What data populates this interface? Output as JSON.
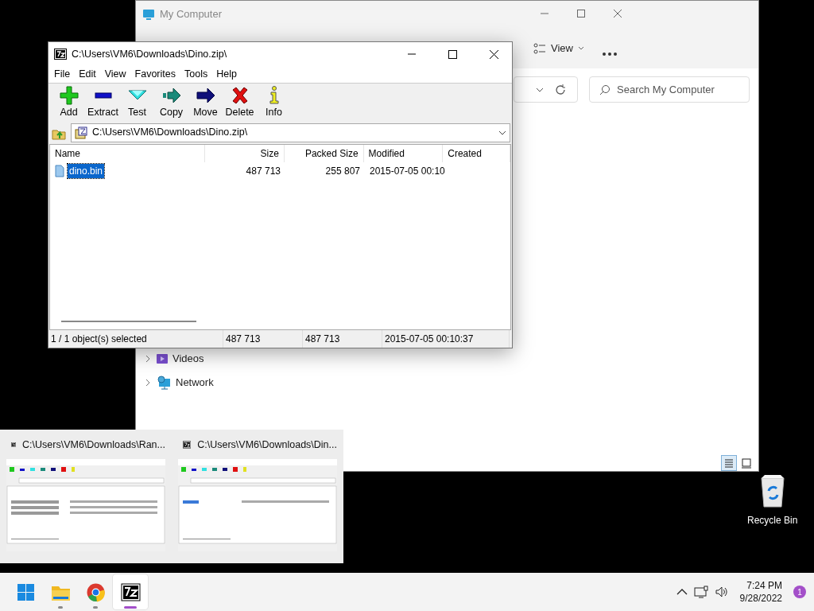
{
  "explorer_window": {
    "title": "My Computer",
    "view_button": "View",
    "search": {
      "placeholder": "Search My Computer"
    },
    "nav_items": [
      {
        "kind": "videos",
        "label": "Videos"
      },
      {
        "kind": "network",
        "label": "Network"
      }
    ],
    "view_toggles": [
      {
        "kind": "details",
        "selected": true
      },
      {
        "kind": "tiles",
        "selected": false
      }
    ]
  },
  "archive_window": {
    "title": "C:\\Users\\VM6\\Downloads\\Dino.zip\\",
    "menu": [
      "File",
      "Edit",
      "View",
      "Favorites",
      "Tools",
      "Help"
    ],
    "toolbar": [
      {
        "kind": "add",
        "label": "Add"
      },
      {
        "kind": "extract",
        "label": "Extract"
      },
      {
        "kind": "test",
        "label": "Test"
      },
      {
        "kind": "copy",
        "label": "Copy"
      },
      {
        "kind": "move",
        "label": "Move"
      },
      {
        "kind": "delete",
        "label": "Delete"
      },
      {
        "kind": "info",
        "label": "Info"
      }
    ],
    "address": "C:\\Users\\VM6\\Downloads\\Dino.zip\\",
    "columns": [
      "Name",
      "Size",
      "Packed Size",
      "Modified",
      "Created"
    ],
    "rows": [
      {
        "name": "dino.bin",
        "size": "487 713",
        "packed_size": "255 807",
        "modified": "2015-07-05 00:10",
        "selected": true
      }
    ],
    "status_bar": [
      "1 / 1 object(s) selected",
      "487 713",
      "487 713",
      "2015-07-05 00:10:37"
    ]
  },
  "task_previews": [
    {
      "title": "C:\\Users\\VM6\\Downloads\\Ran..."
    },
    {
      "title": "C:\\Users\\VM6\\Downloads\\Din..."
    }
  ],
  "desktop_icons": [
    {
      "label": "Recycle Bin"
    }
  ],
  "taskbar": {
    "apps": [
      {
        "kind": "start",
        "active": false
      },
      {
        "kind": "explorer",
        "running": true,
        "active": false
      },
      {
        "kind": "chrome",
        "running": true,
        "active": false
      },
      {
        "kind": "sevenzip",
        "running": true,
        "active": true
      }
    ],
    "time": "7:24 PM",
    "date": "9/28/2022",
    "notifications": "1"
  }
}
